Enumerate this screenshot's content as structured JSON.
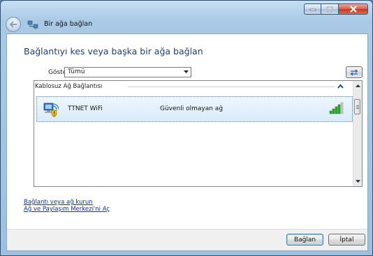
{
  "window": {
    "title": "Bir ağa bağlan",
    "caption_icons": [
      "minimize-icon",
      "maximize-icon",
      "close-icon"
    ]
  },
  "main": {
    "heading": "Bağlantıyı kes veya başka bir ağa bağlan",
    "show_label": "Göster",
    "show_select_value": "Tümü"
  },
  "network_list": {
    "group_label": "Kablosuz Ağ Bağlantısı",
    "networks": [
      {
        "name": "TTNET WiFi",
        "security": "Güvenli olmayan ağ",
        "signal_bars": 5,
        "signal_level": 0.8
      }
    ]
  },
  "links": {
    "setup": "Bağlantı veya ağ kurun",
    "sharing_center": "Ağ ve Paylaşım Merkezi'ni Aç"
  },
  "buttons": {
    "connect": "Bağlan",
    "cancel": "İptal"
  },
  "colors": {
    "heading": "#1f3f78",
    "link": "#0033cc",
    "signal": "#2fa82f",
    "selection": "#d9ebfa"
  }
}
